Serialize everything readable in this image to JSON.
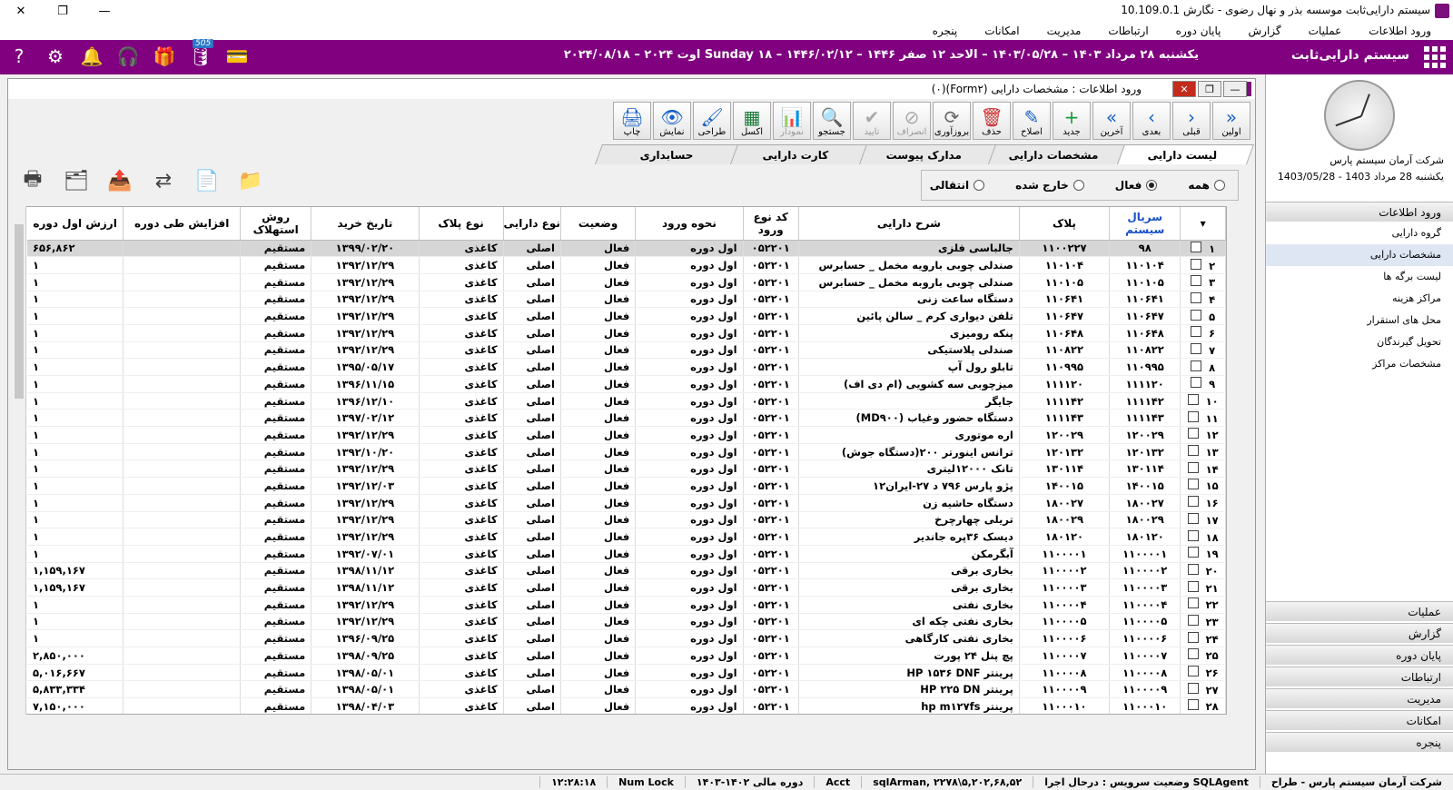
{
  "window": {
    "title": "سیستم دارایی‌ثابت موسسه بذر و نهال رضوی - نگارش 10.109.0.1"
  },
  "menu": [
    "ورود اطلاعات",
    "عملیات",
    "گزارش",
    "پایان دوره",
    "ارتباطات",
    "مدیریت",
    "امکانات",
    "پنجره"
  ],
  "header": {
    "system_name": "سیستم دارایی‌ثابت",
    "date_line": "یکشنبه ۲۸ مرداد ۱۴۰۳ – ۱۴۰۳/۰۵/۲۸ – الاحد ۱۲ صفر ۱۴۴۶ – ۱۴۴۶/۰۲/۱۲ – Sunday ۱۸ اوت ۲۰۲۴ – ۲۰۲۴/۰۸/۱۸",
    "notification_count": "505"
  },
  "side": {
    "company": "شرکت آرمان سیستم پارس",
    "date": "یکشنبه 28 مرداد 1403 - 1403/05/28",
    "section": "ورود اطلاعات",
    "items": [
      "گروه دارایی",
      "مشخصات دارایی",
      "لیست برگه ها",
      "مراکز هزینه",
      "محل های استقرار",
      "تحویل گیرندگان",
      "مشخصات مراکز"
    ],
    "sections": [
      "عملیات",
      "گزارش",
      "پایان دوره",
      "ارتباطات",
      "مدیریت",
      "امکانات",
      "پنجره"
    ]
  },
  "form": {
    "title": "ورود اطلاعات : مشخصات دارایی (Form۲)(۰)",
    "toolbar": [
      "اولین",
      "قبلی",
      "بعدی",
      "آخرین",
      "جدید",
      "اصلاح",
      "حذف",
      "بروزآوری",
      "انصراف",
      "تایید",
      "جستجو",
      "نمودار",
      "اکسل",
      "طراحی",
      "نمایش",
      "چاپ"
    ],
    "tabs": [
      "لیست دارایی",
      "مشخصات دارایی",
      "مدارک پیوست",
      "کارت دارایی",
      "حسابداری"
    ],
    "filters": [
      "همه",
      "فعال",
      "خارج شده",
      "انتقالی"
    ],
    "columns": [
      "سریال سیستم",
      "پلاک",
      "شرح دارایی",
      "کد نوع ورود",
      "نحوه ورود",
      "وضعیت",
      "نوع دارایی",
      "نوع پلاک",
      "تاریخ خرید",
      "روش استهلاک",
      "افزایش طی دوره",
      "ارزش اول دوره"
    ],
    "rows": [
      [
        "۱",
        "۹۸",
        "۱۱۰۰۲۲۷",
        "جالباسی فلزی",
        "۰۵۲۲۰۱",
        "اول دوره",
        "فعال",
        "اصلی",
        "کاغذی",
        "۱۳۹۹/۰۲/۲۰",
        "مستقیم",
        "",
        "۶۵۶,۸۶۲"
      ],
      [
        "۲",
        "۱۱۰۱۰۴",
        "۱۱۰۱۰۴",
        "صندلی چوبی بارویه مخمل _ حسابرس",
        "۰۵۲۲۰۱",
        "اول دوره",
        "فعال",
        "اصلی",
        "کاغذی",
        "۱۳۹۲/۱۲/۲۹",
        "مستقیم",
        "",
        "۱"
      ],
      [
        "۳",
        "۱۱۰۱۰۵",
        "۱۱۰۱۰۵",
        "صندلی چوبی باروبه مخمل _ حسابرس",
        "۰۵۲۲۰۱",
        "اول دوره",
        "فعال",
        "اصلی",
        "کاغذی",
        "۱۳۹۲/۱۲/۲۹",
        "مستقیم",
        "",
        "۱"
      ],
      [
        "۴",
        "۱۱۰۶۴۱",
        "۱۱۰۶۴۱",
        "دستگاه ساعت زنی",
        "۰۵۲۲۰۱",
        "اول دوره",
        "فعال",
        "اصلی",
        "کاغذی",
        "۱۳۹۲/۱۲/۲۹",
        "مستقیم",
        "",
        "۱"
      ],
      [
        "۵",
        "۱۱۰۶۴۷",
        "۱۱۰۶۴۷",
        "تلفن دیواری کرم _ سالن پائین",
        "۰۵۲۲۰۱",
        "اول دوره",
        "فعال",
        "اصلی",
        "کاغذی",
        "۱۳۹۲/۱۲/۲۹",
        "مستقیم",
        "",
        "۱"
      ],
      [
        "۶",
        "۱۱۰۶۴۸",
        "۱۱۰۶۴۸",
        "پنکه رومیزی",
        "۰۵۲۲۰۱",
        "اول دوره",
        "فعال",
        "اصلی",
        "کاغذی",
        "۱۳۹۲/۱۲/۲۹",
        "مستقیم",
        "",
        "۱"
      ],
      [
        "۷",
        "۱۱۰۸۲۲",
        "۱۱۰۸۲۲",
        "صندلی پلاستیکی",
        "۰۵۲۲۰۱",
        "اول دوره",
        "فعال",
        "اصلی",
        "کاغذی",
        "۱۳۹۲/۱۲/۲۹",
        "مستقیم",
        "",
        "۱"
      ],
      [
        "۸",
        "۱۱۰۹۹۵",
        "۱۱۰۹۹۵",
        "تابلو رول آپ",
        "۰۵۲۲۰۱",
        "اول دوره",
        "فعال",
        "اصلی",
        "کاغذی",
        "۱۳۹۵/۰۵/۱۷",
        "مستقیم",
        "",
        "۱"
      ],
      [
        "۹",
        "۱۱۱۱۲۰",
        "۱۱۱۱۲۰",
        "میزچوبی سه کشویی (ام دی اف)",
        "۰۵۲۲۰۱",
        "اول دوره",
        "فعال",
        "اصلی",
        "کاغذی",
        "۱۳۹۶/۱۱/۱۵",
        "مستقیم",
        "",
        "۱"
      ],
      [
        "۱۰",
        "۱۱۱۱۴۲",
        "۱۱۱۱۴۲",
        "جایگر",
        "۰۵۲۲۰۱",
        "اول دوره",
        "فعال",
        "اصلی",
        "کاغذی",
        "۱۳۹۶/۱۲/۱۰",
        "مستقیم",
        "",
        "۱"
      ],
      [
        "۱۱",
        "۱۱۱۱۴۳",
        "۱۱۱۱۴۳",
        "دستگاه حضور وغیاب (MD۹۰۰)",
        "۰۵۲۲۰۱",
        "اول دوره",
        "فعال",
        "اصلی",
        "کاغذی",
        "۱۳۹۷/۰۲/۱۲",
        "مستقیم",
        "",
        "۱"
      ],
      [
        "۱۲",
        "۱۲۰۰۲۹",
        "۱۲۰۰۲۹",
        "اره موتوری",
        "۰۵۲۲۰۱",
        "اول دوره",
        "فعال",
        "اصلی",
        "کاغذی",
        "۱۳۹۲/۱۲/۲۹",
        "مستقیم",
        "",
        "۱"
      ],
      [
        "۱۳",
        "۱۲۰۱۳۲",
        "۱۲۰۱۳۲",
        "ترانس اینورتر ۲۰۰(دستگاه جوش)",
        "۰۵۲۲۰۱",
        "اول دوره",
        "فعال",
        "اصلی",
        "کاغذی",
        "۱۳۹۲/۱۰/۲۰",
        "مستقیم",
        "",
        "۱"
      ],
      [
        "۱۴",
        "۱۳۰۱۱۴",
        "۱۳۰۱۱۴",
        "تانک ۱۲۰۰۰لیتری",
        "۰۵۲۲۰۱",
        "اول دوره",
        "فعال",
        "اصلی",
        "کاغذی",
        "۱۳۹۲/۱۲/۲۹",
        "مستقیم",
        "",
        "۱"
      ],
      [
        "۱۵",
        "۱۴۰۰۱۵",
        "۱۴۰۰۱۵",
        "پژو پارس ۷۹۶ د ۲۷-ایران۱۲",
        "۰۵۲۲۰۱",
        "اول دوره",
        "فعال",
        "اصلی",
        "کاغذی",
        "۱۳۹۲/۱۲/۰۳",
        "مستقیم",
        "",
        "۱"
      ],
      [
        "۱۶",
        "۱۸۰۰۲۷",
        "۱۸۰۰۲۷",
        "دستگاه حاشیه زن",
        "۰۵۲۲۰۱",
        "اول دوره",
        "فعال",
        "اصلی",
        "کاغذی",
        "۱۳۹۲/۱۲/۲۹",
        "مستقیم",
        "",
        "۱"
      ],
      [
        "۱۷",
        "۱۸۰۰۲۹",
        "۱۸۰۰۲۹",
        "تریلی چهارچرخ",
        "۰۵۲۲۰۱",
        "اول دوره",
        "فعال",
        "اصلی",
        "کاغذی",
        "۱۳۹۲/۱۲/۲۹",
        "مستقیم",
        "",
        "۱"
      ],
      [
        "۱۸",
        "۱۸۰۱۲۰",
        "۱۸۰۱۲۰",
        "دیسک ۳۶پره جاندیر",
        "۰۵۲۲۰۱",
        "اول دوره",
        "فعال",
        "اصلی",
        "کاغذی",
        "۱۳۹۲/۱۲/۲۹",
        "مستقیم",
        "",
        "۱"
      ],
      [
        "۱۹",
        "۱۱۰۰۰۰۱",
        "۱۱۰۰۰۰۱",
        "آبگرمکن",
        "۰۵۲۲۰۱",
        "اول دوره",
        "فعال",
        "اصلی",
        "کاغذی",
        "۱۳۹۲/۰۷/۰۱",
        "مستقیم",
        "",
        "۱"
      ],
      [
        "۲۰",
        "۱۱۰۰۰۰۲",
        "۱۱۰۰۰۰۲",
        "بخاری برقی",
        "۰۵۲۲۰۱",
        "اول دوره",
        "فعال",
        "اصلی",
        "کاغذی",
        "۱۳۹۸/۱۱/۱۲",
        "مستقیم",
        "",
        "۱,۱۵۹,۱۶۷"
      ],
      [
        "۲۱",
        "۱۱۰۰۰۰۳",
        "۱۱۰۰۰۰۳",
        "بخاری برقی",
        "۰۵۲۲۰۱",
        "اول دوره",
        "فعال",
        "اصلی",
        "کاغذی",
        "۱۳۹۸/۱۱/۱۲",
        "مستقیم",
        "",
        "۱,۱۵۹,۱۶۷"
      ],
      [
        "۲۲",
        "۱۱۰۰۰۰۴",
        "۱۱۰۰۰۰۴",
        "بخاری نفتی",
        "۰۵۲۲۰۱",
        "اول دوره",
        "فعال",
        "اصلی",
        "کاغذی",
        "۱۳۹۲/۱۲/۲۹",
        "مستقیم",
        "",
        "۱"
      ],
      [
        "۲۳",
        "۱۱۰۰۰۰۵",
        "۱۱۰۰۰۰۵",
        "بخاری نفتی چکه ای",
        "۰۵۲۲۰۱",
        "اول دوره",
        "فعال",
        "اصلی",
        "کاغذی",
        "۱۳۹۲/۱۲/۲۹",
        "مستقیم",
        "",
        "۱"
      ],
      [
        "۲۴",
        "۱۱۰۰۰۰۶",
        "۱۱۰۰۰۰۶",
        "بخاری نفتی کارگاهی",
        "۰۵۲۲۰۱",
        "اول دوره",
        "فعال",
        "اصلی",
        "کاغذی",
        "۱۳۹۶/۰۹/۲۵",
        "مستقیم",
        "",
        "۱"
      ],
      [
        "۲۵",
        "۱۱۰۰۰۰۷",
        "۱۱۰۰۰۰۷",
        "پچ پنل ۲۴ پورت",
        "۰۵۲۲۰۱",
        "اول دوره",
        "فعال",
        "اصلی",
        "کاغذی",
        "۱۳۹۸/۰۹/۲۵",
        "مستقیم",
        "",
        "۲,۸۵۰,۰۰۰"
      ],
      [
        "۲۶",
        "۱۱۰۰۰۰۸",
        "۱۱۰۰۰۰۸",
        "پرینتر HP ۱۵۳۶ DNF",
        "۰۵۲۲۰۱",
        "اول دوره",
        "فعال",
        "اصلی",
        "کاغذی",
        "۱۳۹۸/۰۵/۰۱",
        "مستقیم",
        "",
        "۵,۰۱۶,۶۶۷"
      ],
      [
        "۲۷",
        "۱۱۰۰۰۰۹",
        "۱۱۰۰۰۰۹",
        "پرینتر HP ۲۲۵ DN",
        "۰۵۲۲۰۱",
        "اول دوره",
        "فعال",
        "اصلی",
        "کاغذی",
        "۱۳۹۸/۰۵/۰۱",
        "مستقیم",
        "",
        "۵,۸۳۳,۳۳۴"
      ],
      [
        "۲۸",
        "۱۱۰۰۰۱۰",
        "۱۱۰۰۰۱۰",
        "پرینتر hp m۱۲۷fs",
        "۰۵۲۲۰۱",
        "اول دوره",
        "فعال",
        "اصلی",
        "کاغذی",
        "۱۳۹۸/۰۴/۰۳",
        "مستقیم",
        "",
        "۷,۱۵۰,۰۰۰"
      ]
    ]
  },
  "status": [
    "شرکت آرمان سیستم پارس - طراح",
    "SQLAgent وضعیت سرویس : درحال اجرا",
    "۵,۲۰۲,۶۸,۵۲\\sqlArman, ۲۲۷۸",
    "Acct",
    "دوره مالی ۱۴۰۲-۱۴۰۳",
    "Num Lock",
    "۱۲:۲۸:۱۸"
  ]
}
